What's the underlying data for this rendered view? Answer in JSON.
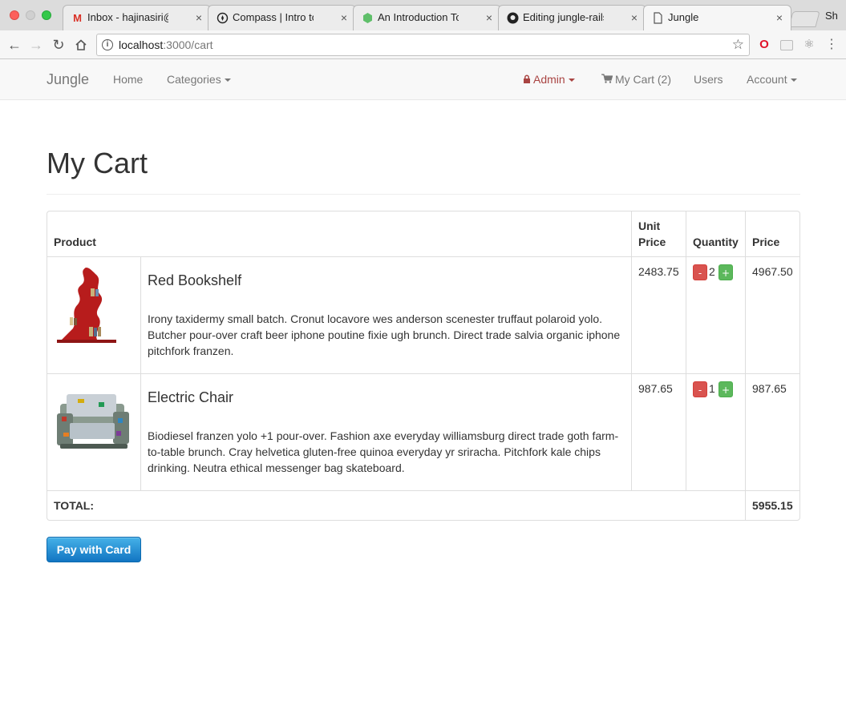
{
  "browser": {
    "tabs": [
      {
        "icon": "gmail-icon",
        "title": "Inbox - hajinasiri@gm..."
      },
      {
        "icon": "compass-icon",
        "title": "Compass | Intro to RSpec"
      },
      {
        "icon": "hex-icon",
        "title": "An Introduction To RSpec"
      },
      {
        "icon": "github-icon",
        "title": "Editing jungle-rails/README"
      },
      {
        "icon": "page-icon",
        "title": "Jungle"
      }
    ],
    "profile_label": "Sh",
    "url_host": "localhost",
    "url_rest": ":3000/cart",
    "close_glyph": "×"
  },
  "navbar": {
    "brand": "Jungle",
    "home": "Home",
    "categories": "Categories",
    "admin": "Admin",
    "cart": "My Cart (2)",
    "users": "Users",
    "account": "Account"
  },
  "page": {
    "title": "My Cart"
  },
  "cart": {
    "headers": {
      "product": "Product",
      "unit_price_1": "Unit",
      "unit_price_2": "Price",
      "quantity": "Quantity",
      "price": "Price"
    },
    "items": [
      {
        "name": "Red Bookshelf",
        "description": "Irony taxidermy small batch. Cronut locavore wes anderson scenester truffaut polaroid yolo. Butcher pour-over craft beer iphone poutine fixie ugh brunch. Direct trade salvia organic iphone pitchfork franzen.",
        "unit_price": "2483.75",
        "quantity": "2",
        "price": "4967.50"
      },
      {
        "name": "Electric Chair",
        "description": "Biodiesel franzen yolo +1 pour-over. Fashion axe everyday williamsburg direct trade goth farm-to-table brunch. Cray helvetica gluten-free quinoa everyday yr sriracha. Pitchfork kale chips drinking. Neutra ethical messenger bag skateboard.",
        "unit_price": "987.65",
        "quantity": "1",
        "price": "987.65"
      }
    ],
    "minus_label": "-",
    "plus_label": "+",
    "total_label": "TOTAL:",
    "total_value": "5955.15"
  },
  "checkout": {
    "pay_label": "Pay with Card"
  },
  "colors": {
    "accent_blue": "#1275c2",
    "danger": "#d9534f",
    "success": "#5cb85c",
    "admin_red": "#a94442"
  }
}
